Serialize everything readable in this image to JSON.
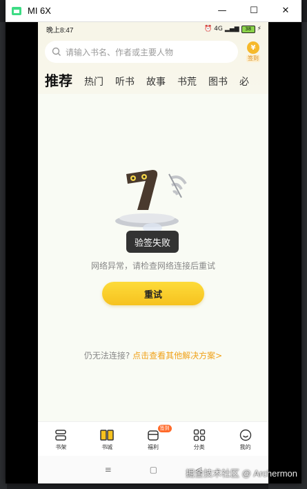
{
  "window": {
    "title": "MI 6X",
    "minimize": "—",
    "maximize": "☐",
    "close": "✕"
  },
  "status_bar": {
    "time": "晚上8:47",
    "signal": "4G",
    "battery": "38"
  },
  "search": {
    "placeholder": "请输入书名、作者或主要人物"
  },
  "signin": {
    "label": "签到",
    "coin": "¥"
  },
  "tabs": [
    "推荐",
    "热门",
    "听书",
    "故事",
    "书荒",
    "图书",
    "必"
  ],
  "toast": "验签失败",
  "error": {
    "message": "网络异常，请检查网络连接后重试",
    "retry_label": "重试"
  },
  "help": {
    "question": "仍无法连接?",
    "link": "点击查看其他解决方案>"
  },
  "bottom_nav": [
    {
      "label": "书架",
      "icon": "bookshelf-icon"
    },
    {
      "label": "书城",
      "icon": "bookstore-icon"
    },
    {
      "label": "福利",
      "icon": "gift-icon",
      "badge": "签到"
    },
    {
      "label": "分类",
      "icon": "category-icon"
    },
    {
      "label": "我的",
      "icon": "profile-icon"
    }
  ],
  "system_nav": {
    "menu": "≡",
    "home": "▢",
    "back": "◁"
  },
  "watermark": "掘金技术社区 @ Archermon",
  "colors": {
    "accent": "#f6c21f",
    "link": "#f0a21a",
    "toast_bg": "#333333",
    "badge": "#ff6a2a"
  }
}
